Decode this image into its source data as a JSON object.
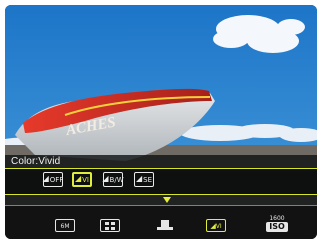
{
  "menu": {
    "title": "Color:Vivid",
    "options": [
      {
        "label": "OFF",
        "icon": "color-off-icon",
        "selected": false
      },
      {
        "label": "VI",
        "icon": "color-vivid-icon",
        "selected": true
      },
      {
        "label": "B/W",
        "icon": "color-bw-icon",
        "selected": false
      },
      {
        "label": "SE",
        "icon": "color-sepia-icon",
        "selected": false
      }
    ]
  },
  "bottom_bar": {
    "items": [
      {
        "label": "6M",
        "icon": "image-size-icon"
      },
      {
        "label": "",
        "icon": "quality-icon"
      },
      {
        "label": "",
        "icon": "white-balance-icon"
      },
      {
        "label": "VI",
        "icon": "color-mode-icon",
        "selected": true
      }
    ],
    "iso": {
      "value": "1600",
      "label": "ISO"
    }
  },
  "scene": {
    "boat_text": "ACHES"
  },
  "colors": {
    "accent": "#e0ee3a",
    "sky": "#1f7fd0",
    "boat_red": "#c62a22"
  }
}
